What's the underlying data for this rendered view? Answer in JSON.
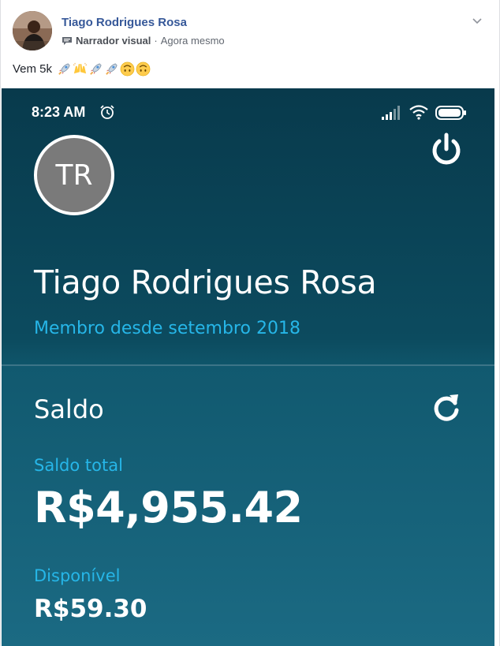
{
  "post": {
    "author": "Tiago Rodrigues Rosa",
    "context_label": "Narrador visual",
    "separator": "·",
    "timestamp": "Agora mesmo",
    "text": "Vem 5k",
    "emojis": [
      "rocket",
      "raising-hands",
      "rocket",
      "rocket",
      "upside-down-face",
      "upside-down-face"
    ],
    "icons": {
      "context": "speech-bubble-icon",
      "menu": "chevron-down-icon"
    },
    "colors": {
      "author": "#365899",
      "meta": "#616770"
    }
  },
  "phone": {
    "status_bar": {
      "time": "8:23 AM",
      "icons": [
        "alarm-icon",
        "signal-icon",
        "wifi-icon",
        "battery-icon"
      ]
    },
    "profile": {
      "initials": "TR",
      "name": "Tiago Rodrigues Rosa",
      "member_since": "Membro desde setembro 2018"
    },
    "balance": {
      "title": "Saldo",
      "total_label": "Saldo total",
      "total_value": "R$4,955.42",
      "available_label": "Disponível",
      "available_value": "R$59.30"
    },
    "icons": {
      "logout": "power-icon",
      "refresh": "refresh-icon"
    },
    "colors": {
      "background_top": "#083a4c",
      "background_bottom": "#1b6a83",
      "accent": "#26b6e8",
      "text": "#ffffff"
    }
  }
}
